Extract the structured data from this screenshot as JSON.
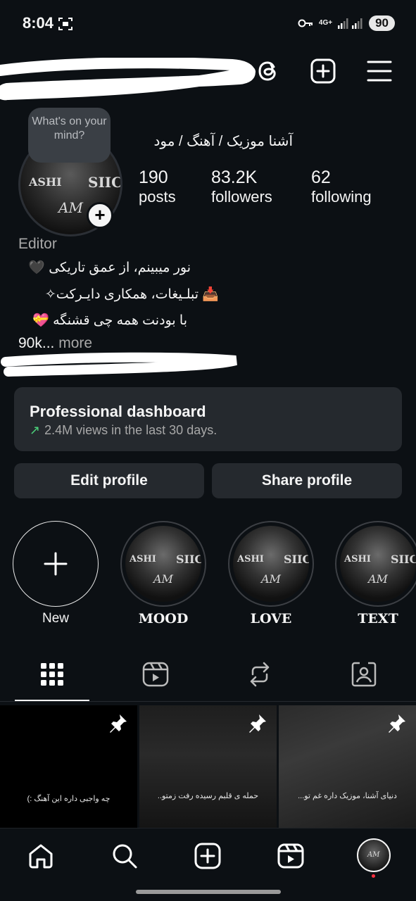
{
  "status_bar": {
    "time": "8:04",
    "network": "4G+",
    "battery": "90"
  },
  "profile": {
    "note_bubble": "What's on your mind?",
    "display_name": "آشنا موزیک / آهنگ / مود",
    "avatar_text": {
      "left": "ASHI",
      "right": "SIIC",
      "center": "AM"
    },
    "stats": [
      {
        "value": "190",
        "label": "posts"
      },
      {
        "value": "83.2K",
        "label": "followers"
      },
      {
        "value": "62",
        "label": "following"
      }
    ],
    "category": "Editor",
    "bio": [
      "نور میبینم، از عمق تاریکی 🖤",
      "📥 تبلـیغات، همکاری دایـرکت✧",
      "با بودنت همه چی قشنگه 💝"
    ],
    "bio_prefix": "90k...",
    "bio_more": " more"
  },
  "dashboard": {
    "title": "Professional dashboard",
    "arrow": "↗",
    "subtitle": "2.4M views in the last 30 days."
  },
  "actions": {
    "edit": "Edit profile",
    "share": "Share profile"
  },
  "highlights": [
    {
      "label": "New",
      "icon": "plus-icon"
    },
    {
      "label": "MOOD"
    },
    {
      "label": "LOVE"
    },
    {
      "label": "TEXT"
    }
  ],
  "tabs": [
    "grid-icon",
    "reels-icon",
    "reposts-icon",
    "tagged-icon"
  ],
  "posts": [
    {
      "caption": "چه واجبی داره این آهنگ :)",
      "pinned": true
    },
    {
      "caption": "حمله ی قلبم رسیده رفت زمتو..",
      "pinned": true
    },
    {
      "caption": "دنیای آشنا، موزیک داره غم تو...",
      "pinned": true
    }
  ],
  "bottom_nav": [
    "home-icon",
    "search-icon",
    "create-icon",
    "reels-icon",
    "profile-avatar"
  ]
}
